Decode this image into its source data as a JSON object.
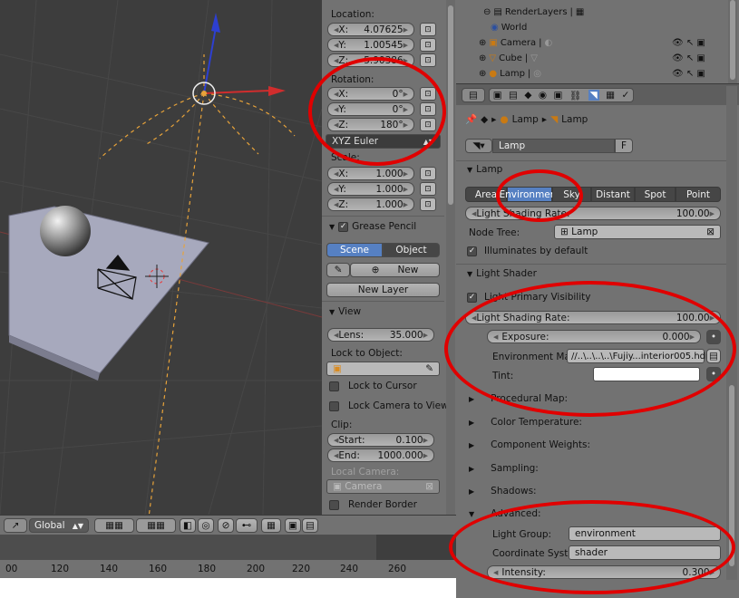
{
  "viewport": {
    "orientation_mode": "Global",
    "timeline_ticks": [
      "00",
      "120",
      "140",
      "160",
      "180",
      "200",
      "220",
      "240",
      "260"
    ]
  },
  "transform": {
    "location_label": "Location:",
    "location": [
      {
        "axis": "X:",
        "value": "4.07625"
      },
      {
        "axis": "Y:",
        "value": "1.00545"
      },
      {
        "axis": "Z:",
        "value": "5.90386"
      }
    ],
    "rotation_label": "Rotation:",
    "rotation": [
      {
        "axis": "X:",
        "value": "0°"
      },
      {
        "axis": "Y:",
        "value": "0°"
      },
      {
        "axis": "Z:",
        "value": "180°"
      }
    ],
    "rotation_mode": "XYZ Euler",
    "scale_label": "Scale:",
    "scale": [
      {
        "axis": "X:",
        "value": "1.000"
      },
      {
        "axis": "Y:",
        "value": "1.000"
      },
      {
        "axis": "Z:",
        "value": "1.000"
      }
    ]
  },
  "grease_pencil": {
    "title": "Grease Pencil",
    "tab_scene": "Scene",
    "tab_object": "Object",
    "new_label": "New",
    "new_layer_label": "New Layer"
  },
  "view": {
    "title": "View",
    "lens_label": "Lens:",
    "lens_value": "35.000",
    "lock_to_object_label": "Lock to Object:",
    "lock_to_cursor_label": "Lock to Cursor",
    "lock_camera_label": "Lock Camera to View",
    "clip_label": "Clip:",
    "clip_start_label": "Start:",
    "clip_start_value": "0.100",
    "clip_end_label": "End:",
    "clip_end_value": "1000.000",
    "local_camera_label": "Local Camera:",
    "local_camera_value": "Camera",
    "render_border_label": "Render Border"
  },
  "outliner": {
    "items": [
      {
        "name": "RenderLayers"
      },
      {
        "name": "World"
      },
      {
        "name": "Camera"
      },
      {
        "name": "Cube"
      },
      {
        "name": "Lamp"
      }
    ]
  },
  "properties": {
    "breadcrumb": [
      "Lamp",
      "Lamp"
    ],
    "datablock_name": "Lamp",
    "datablock_fake": "F",
    "lamp_panel_title": "Lamp",
    "lamp_types": [
      "Area",
      "Environment",
      "Sky",
      "Distant",
      "Spot",
      "Point"
    ],
    "selected_lamp_type": "Environment",
    "light_shading_rate_label": "Light Shading Rate:",
    "light_shading_rate_value": "100.00",
    "node_tree_label": "Node Tree:",
    "node_tree_value": "Lamp",
    "illuminates_label": "Illuminates by default",
    "light_shader_title": "Light Shader",
    "light_primary_visibility_label": "Light Primary Visibility",
    "shader_rate_label": "Light Shading Rate:",
    "shader_rate_value": "100.00",
    "exposure_label": "Exposure:",
    "exposure_value": "0.000",
    "env_map_label": "Environment Map:",
    "env_map_value": "//..\\..\\..\\..\\Fujiy...interior005.hdr",
    "tint_label": "Tint:",
    "subpanels": [
      "Procedural Map:",
      "Color Temperature:",
      "Component Weights:",
      "Sampling:",
      "Shadows:"
    ],
    "advanced_label": "Advanced:",
    "light_group_label": "Light Group:",
    "light_group_value": "environment",
    "coord_sys_label": "Coordinate Syst...",
    "coord_sys_value": "shader",
    "intensity_label": "Intensity:",
    "intensity_value": "0.300"
  },
  "colors": {
    "highlight": "#e00000",
    "selected_blue": "#5680c2"
  }
}
